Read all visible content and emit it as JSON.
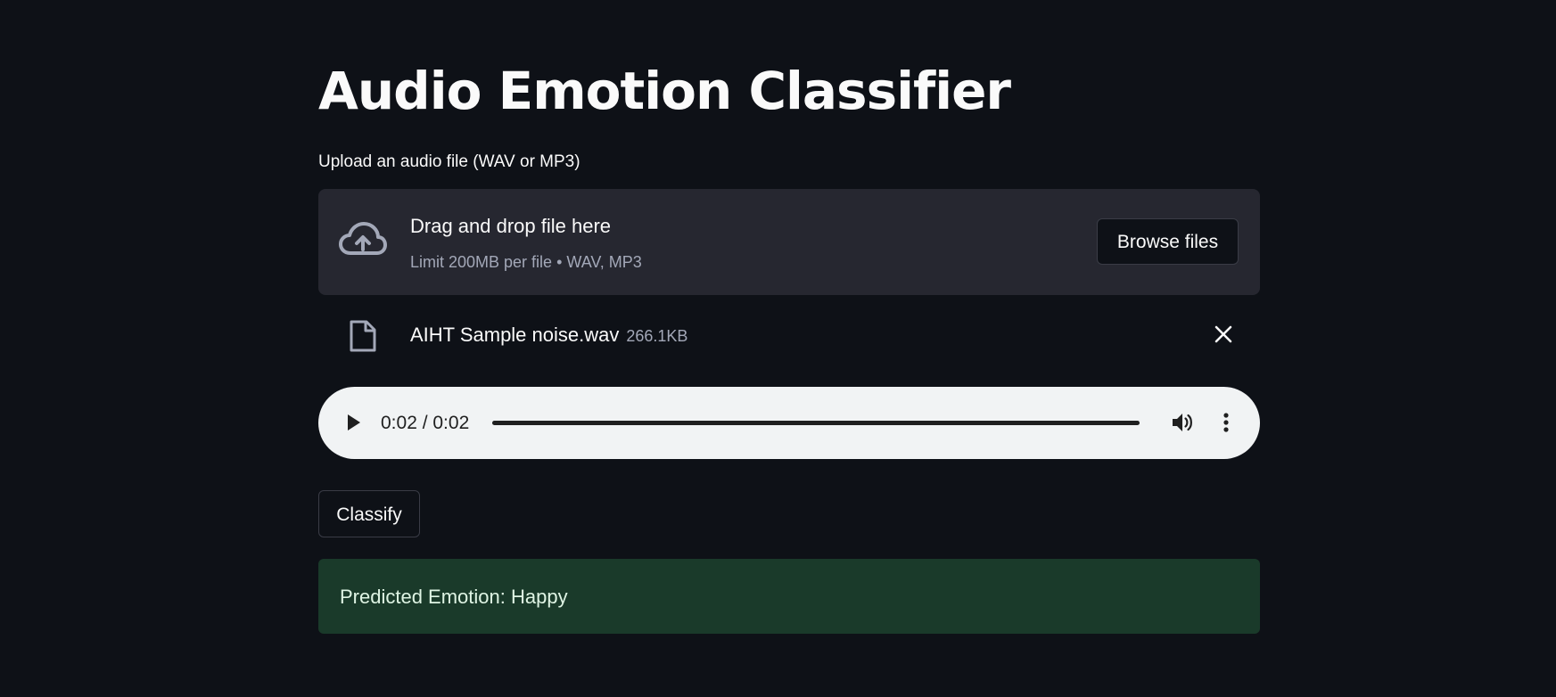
{
  "page": {
    "title": "Audio Emotion Classifier"
  },
  "uploader": {
    "label": "Upload an audio file (WAV or MP3)",
    "drop_title": "Drag and drop file here",
    "drop_limit": "Limit 200MB per file • WAV, MP3",
    "browse_label": "Browse files",
    "icon": "cloud-upload-icon"
  },
  "file": {
    "name": "AIHT Sample noise.wav",
    "size": "266.1KB",
    "icon": "file-icon",
    "remove_icon": "close-icon"
  },
  "player": {
    "time": "0:02 / 0:02",
    "progress": 1.0,
    "icons": [
      "play-icon",
      "volume-icon",
      "more-vertical-icon"
    ]
  },
  "actions": {
    "classify_label": "Classify"
  },
  "result": {
    "text": "Predicted Emotion: Happy",
    "color": "#1a3a2a"
  },
  "colors": {
    "background": "#0e1117",
    "panel": "#262730",
    "player": "#f1f3f4"
  }
}
